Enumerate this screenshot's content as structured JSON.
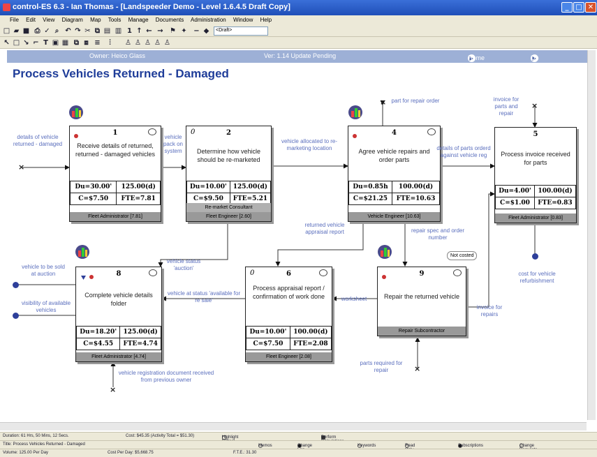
{
  "window": {
    "title": "control-ES 6.3 - Ian Thomas - [Landspeeder Demo - Level 1.6.4.5 Draft Copy]",
    "controls": {
      "minimize": "_",
      "maximize": "□",
      "close": "✕"
    }
  },
  "menu": [
    "File",
    "Edit",
    "View",
    "Diagram",
    "Map",
    "Tools",
    "Manage",
    "Documents",
    "Administration",
    "Window",
    "Help"
  ],
  "toolbar": {
    "draft_select": "<Draft>"
  },
  "infobar": {
    "owner": "Owner: Heico Glass",
    "version": "Ver: 1.14   Update Pending",
    "home": "Home",
    "up_level": "Up a level"
  },
  "page_title": "Process  Vehicles Returned - Damaged",
  "activities": [
    {
      "num": "1",
      "title": "Receive details of returned, returned - damaged vehicles",
      "du": "Du=30.00'",
      "vol": "125.00(d)",
      "cost": "C=$7.50",
      "fte": "FTE=7.81",
      "role": "Fleet Administrator [7.81]"
    },
    {
      "num": "2",
      "title": "Determine how vehicle should be re-marketed",
      "du": "Du=10.00'",
      "vol": "125.00(d)",
      "cost": "C=$9.50",
      "fte": "FTE=5.21",
      "role1": "Re-market Consultant",
      "role": "Fleet Engineer [2.60]"
    },
    {
      "num": "4",
      "title": "Agree vehicle repairs and order parts",
      "du": "Du=0.85h",
      "vol": "100.00(d)",
      "cost": "C=$21.25",
      "fte": "FTE=10.63",
      "role": "Vehicle Engineer [10.63]"
    },
    {
      "num": "5",
      "title": "Process invoice received for parts",
      "du": "Du=4.00'",
      "vol": "100.00(d)",
      "cost": "C=$1.00",
      "fte": "FTE=0.83",
      "role": "Fleet Administrator [0.83]"
    },
    {
      "num": "8",
      "title": "Complete vehicle details folder",
      "du": "Du=18.20'",
      "vol": "125.00(d)",
      "cost": "C=$4.55",
      "fte": "FTE=4.74",
      "role": "Fleet Administrator [4.74]"
    },
    {
      "num": "6",
      "title": "Process  appraisal report / confirmation of work done",
      "du": "Du=10.00'",
      "vol": "100.00(d)",
      "cost": "C=$7.50",
      "fte": "FTE=2.08",
      "role": "Fleet Engineer [2.08]"
    },
    {
      "num": "9",
      "title": "Repair the returned vehicle",
      "role": "Repair Subcontractor",
      "callout": "Not costed"
    }
  ],
  "labels": {
    "in1": "details of vehicle returned - damaged",
    "flow12": "vehicle pack on system",
    "flow24": "vehicle allocated to re-marketing location",
    "partrepair": "part for repair order",
    "flow45": "details of parts orderd against vehicle reg",
    "invoice_parts": "invoice for parts and repair",
    "returned": "returned vehicle appraisal report",
    "repairspec": "repair spec and order number",
    "vstatus": "vehicle status 'auction'",
    "sold": "vehicle to be sold at auction",
    "visibility": "visibility of available vehicles",
    "resale": "vehicle at status 'available for re sale'",
    "worksheet": "worksheet",
    "inv_repairs": "invoice for repairs",
    "costrefurb": "cost for vehicle refurbishment",
    "regdoc": "vehicle registration document received from previous owner",
    "partsreq": "parts required for repair"
  },
  "status": {
    "duration": "Duration: 61 Hrs, 50 Mins, 12 Secs.",
    "cost": "Cost: $45.35 (Activity Total = $51.30)",
    "highlight": "Highlight Critical Path",
    "perform": "Perform Calculations",
    "title": "Title: Process Vehicles Returned - Damaged",
    "memos": "Memos",
    "changelog": "Change Log",
    "keywords": "Keywords",
    "readonly": "Read Only",
    "subscriptions": "Subscriptions",
    "changereq": "Change Requests",
    "volume": "Volume: 125.00 Per Day",
    "costperday": "Cost Per Day: $5,668.75",
    "fte": "F.T.E.: 31.30"
  },
  "colors": {
    "accent": "#1f3d99",
    "flow_label": "#5a6ebd",
    "infobar": "#9db0d6",
    "role_bar": "#999999"
  }
}
